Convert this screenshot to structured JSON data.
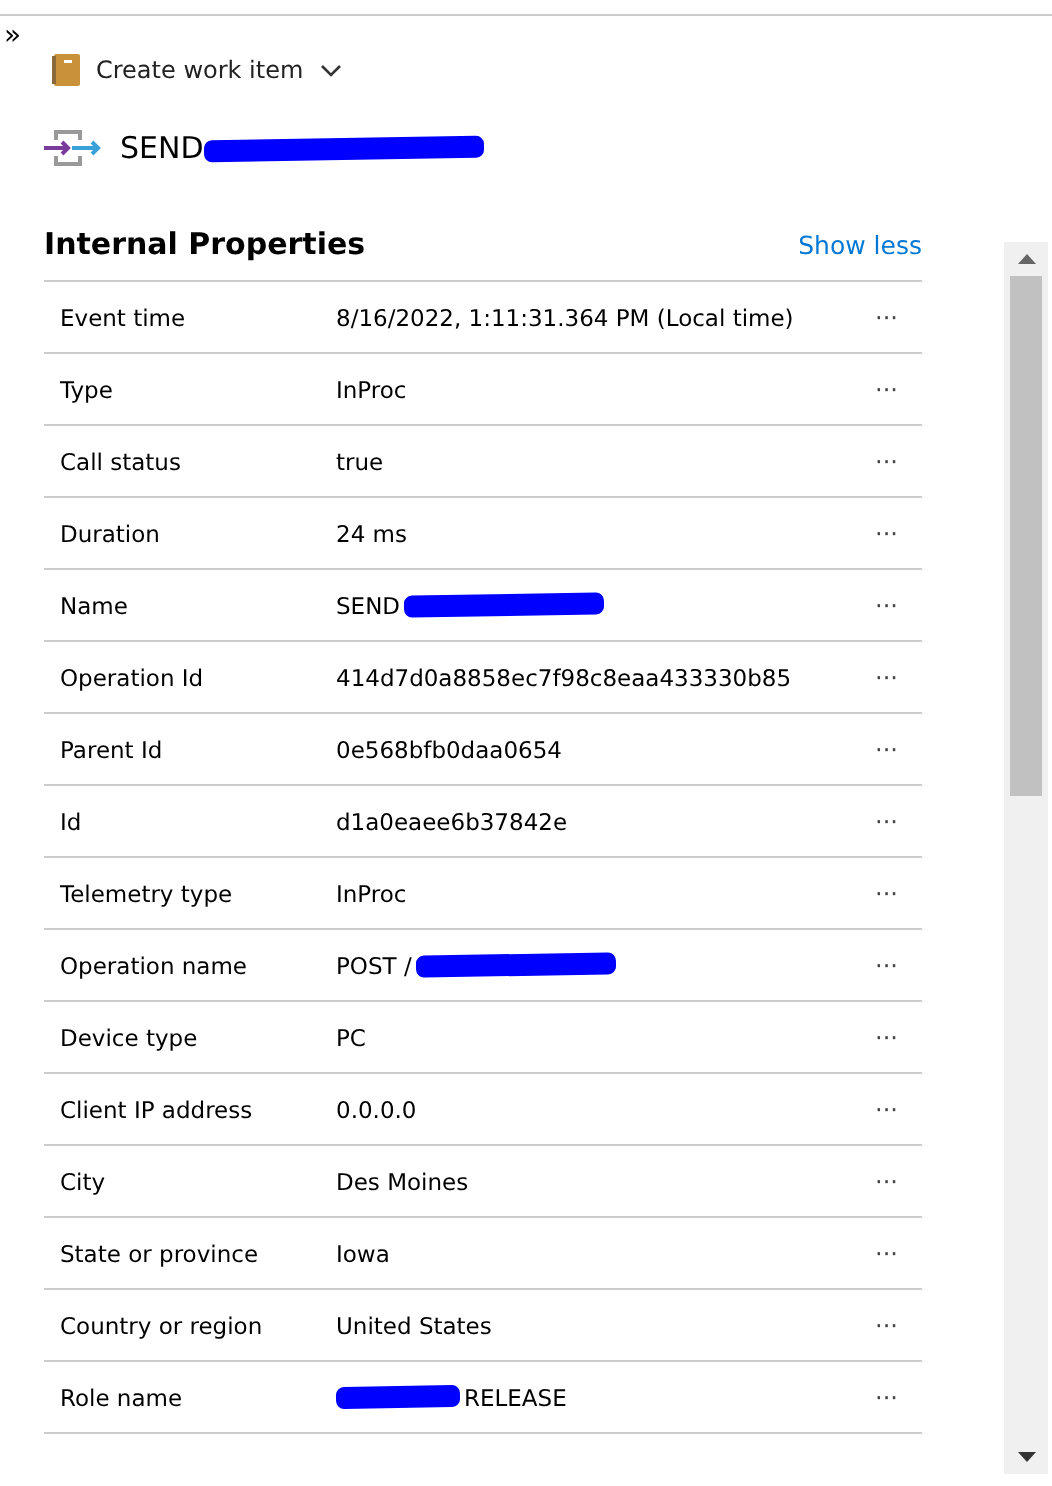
{
  "toolbar": {
    "expand_glyph": "»",
    "action": "Create work item"
  },
  "header": {
    "title": "SEND",
    "redacted_after": true
  },
  "section": {
    "title": "Internal Properties",
    "toggle": "Show less"
  },
  "rows": [
    {
      "label": "Event time",
      "value": "8/16/2022, 1:11:31.364 PM (Local time)",
      "more": "···"
    },
    {
      "label": "Type",
      "value": "InProc",
      "more": "···"
    },
    {
      "label": "Call status",
      "value": "true",
      "more": "···"
    },
    {
      "label": "Duration",
      "value": "24 ms",
      "more": "···"
    },
    {
      "label": "Name",
      "value": "SEND",
      "redacted_after": true,
      "more": "···"
    },
    {
      "label": "Operation Id",
      "value": "414d7d0a8858ec7f98c8eaa433330b85",
      "more": "···"
    },
    {
      "label": "Parent Id",
      "value": "0e568bfb0daa0654",
      "more": "···"
    },
    {
      "label": "Id",
      "value": "d1a0eaee6b37842e",
      "more": "···"
    },
    {
      "label": "Telemetry type",
      "value": "InProc",
      "more": "···"
    },
    {
      "label": "Operation name",
      "value": "POST /",
      "redacted_after": true,
      "more": "···"
    },
    {
      "label": "Device type",
      "value": "PC",
      "more": "···"
    },
    {
      "label": "Client IP address",
      "value": "0.0.0.0",
      "more": "···"
    },
    {
      "label": "City",
      "value": "Des Moines",
      "more": "···"
    },
    {
      "label": "State or province",
      "value": "Iowa",
      "more": "···"
    },
    {
      "label": "Country or region",
      "value": "United States",
      "more": "···"
    },
    {
      "label": "Role name",
      "value": "RELEASE",
      "redacted_before": true,
      "more": "···"
    }
  ]
}
